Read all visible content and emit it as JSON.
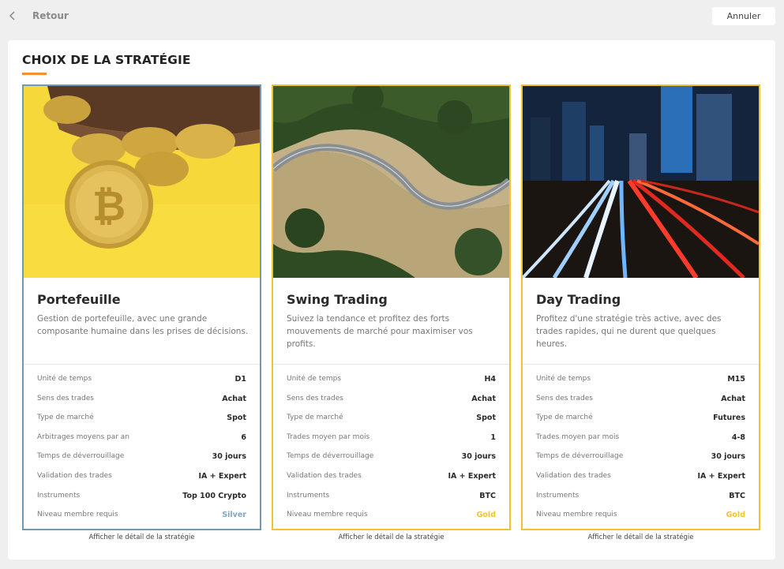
{
  "header": {
    "back_label": "Retour",
    "cancel_label": "Annuler"
  },
  "page_title": "CHOIX DE LA STRATÉGIE",
  "colors": {
    "accent": "#f0922f",
    "card_silver_border": "#6e9ab8",
    "card_gold_border": "#f2c230",
    "silver_text": "#7fa6c4",
    "gold_text": "#f2c230"
  },
  "cards": [
    {
      "image_name": "bitcoin-wallet-image",
      "title": "Portefeuille",
      "description": "Gestion de portefeuille, avec une grande composante humaine dans les prises de décisions.",
      "rows": [
        {
          "label": "Unité de temps",
          "value": "D1"
        },
        {
          "label": "Sens des trades",
          "value": "Achat"
        },
        {
          "label": "Type de marché",
          "value": "Spot"
        },
        {
          "label": "Arbitrages moyens par an",
          "value": "6"
        },
        {
          "label": "Temps de déverrouillage",
          "value": "30 jours"
        },
        {
          "label": "Validation des trades",
          "value": "IA + Expert"
        },
        {
          "label": "Instruments",
          "value": "Top 100 Crypto"
        },
        {
          "label": "Niveau membre requis",
          "value": "Silver"
        }
      ],
      "detail_link": "Afficher le détail de la stratégie"
    },
    {
      "image_name": "winding-road-forest-image",
      "title": "Swing Trading",
      "description": "Suivez la tendance et profitez des forts mouvements de marché pour maximiser vos profits.",
      "rows": [
        {
          "label": "Unité de temps",
          "value": "H4"
        },
        {
          "label": "Sens des trades",
          "value": "Achat"
        },
        {
          "label": "Type de marché",
          "value": "Spot"
        },
        {
          "label": "Trades moyen par mois",
          "value": "1"
        },
        {
          "label": "Temps de déverrouillage",
          "value": "30 jours"
        },
        {
          "label": "Validation des trades",
          "value": "IA + Expert"
        },
        {
          "label": "Instruments",
          "value": "BTC"
        },
        {
          "label": "Niveau membre requis",
          "value": "Gold"
        }
      ],
      "detail_link": "Afficher le détail de la stratégie"
    },
    {
      "image_name": "city-light-trails-image",
      "title": "Day Trading",
      "description": "Profitez d'une stratégie très active, avec des trades rapides, qui ne durent que quelques heures.",
      "rows": [
        {
          "label": "Unité de temps",
          "value": "M15"
        },
        {
          "label": "Sens des trades",
          "value": "Achat"
        },
        {
          "label": "Type de marché",
          "value": "Futures"
        },
        {
          "label": "Trades moyen par mois",
          "value": "4-8"
        },
        {
          "label": "Temps de déverrouillage",
          "value": "30 jours"
        },
        {
          "label": "Validation des trades",
          "value": "IA + Expert"
        },
        {
          "label": "Instruments",
          "value": "BTC"
        },
        {
          "label": "Niveau membre requis",
          "value": "Gold"
        }
      ],
      "detail_link": "Afficher le détail de la stratégie"
    }
  ]
}
